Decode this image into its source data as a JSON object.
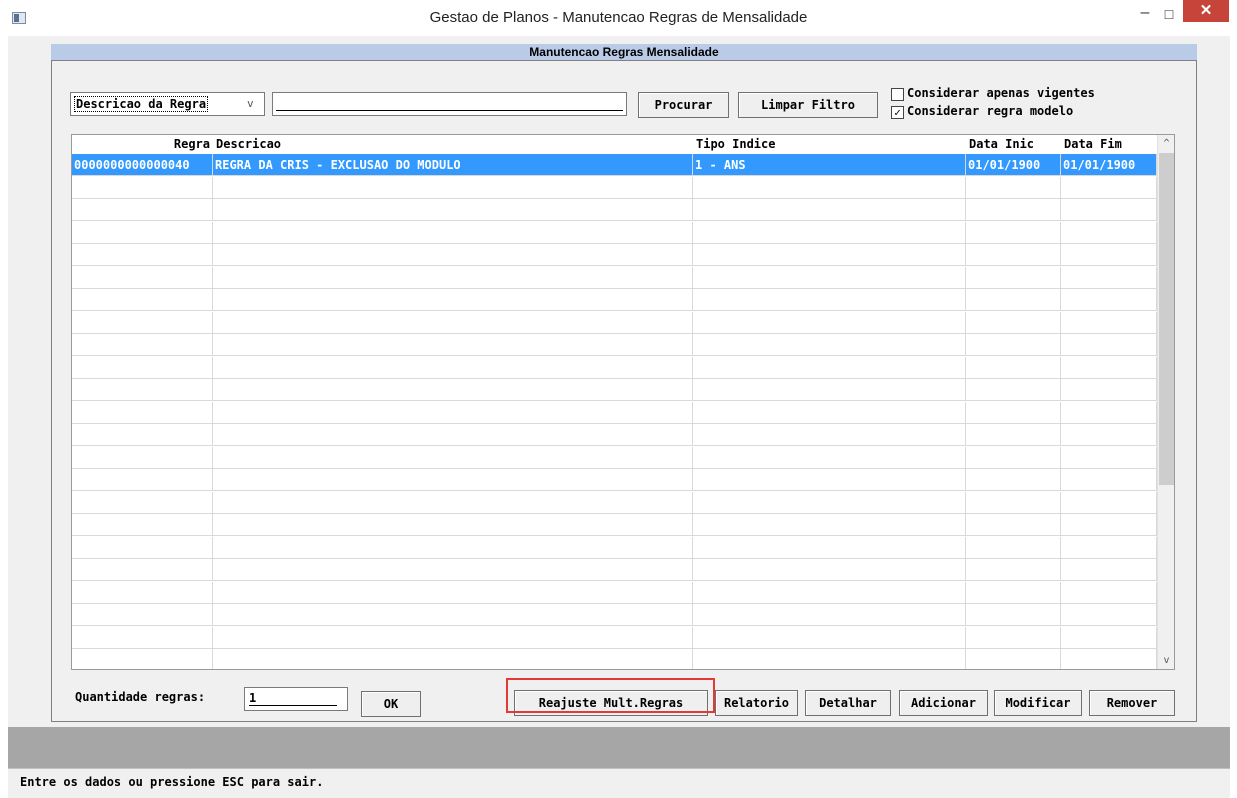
{
  "window": {
    "title": "Gestao de Planos - Manutencao Regras de Mensalidade",
    "minimize": "–",
    "maximize": "☐",
    "close": "✕"
  },
  "panel": {
    "title": "Manutencao Regras Mensalidade"
  },
  "filter": {
    "field_selected": "Descricao da Regra",
    "field_arrow": "v",
    "search_value": "",
    "search_button": "Procurar",
    "clear_button": "Limpar Filtro",
    "only_active_label": "Considerar apenas vigentes",
    "only_active_checked": false,
    "model_rule_label": "Considerar regra modelo",
    "model_rule_checked": true
  },
  "table": {
    "columns": [
      "Regra",
      "Descricao",
      "Tipo Indice",
      "Data Inic",
      "Data Fim"
    ],
    "rows": [
      {
        "regra": "0000000000000040",
        "descricao": "REGRA DA CRIS - EXCLUSAO DO MODULO",
        "tipo_indice": "1 - ANS",
        "data_inic": "01/01/1900",
        "data_fim": "01/01/1900",
        "selected": true
      }
    ],
    "scroll_up": "^",
    "scroll_down": "v"
  },
  "footer": {
    "quantity_label": "Quantidade regras:",
    "quantity_value": "1",
    "ok_button": "OK",
    "buttons": {
      "reajuste": "Reajuste Mult.Regras",
      "relatorio": "Relatorio",
      "detalhar": "Detalhar",
      "adicionar": "Adicionar",
      "modificar": "Modificar",
      "remover": "Remover"
    },
    "highlight_color": "#e53935"
  },
  "status": {
    "message": "Entre os dados ou pressione ESC para sair."
  },
  "colors": {
    "selection": "#3399ff",
    "panel_header": "#b9cbe6",
    "close_button": "#c7443a"
  }
}
